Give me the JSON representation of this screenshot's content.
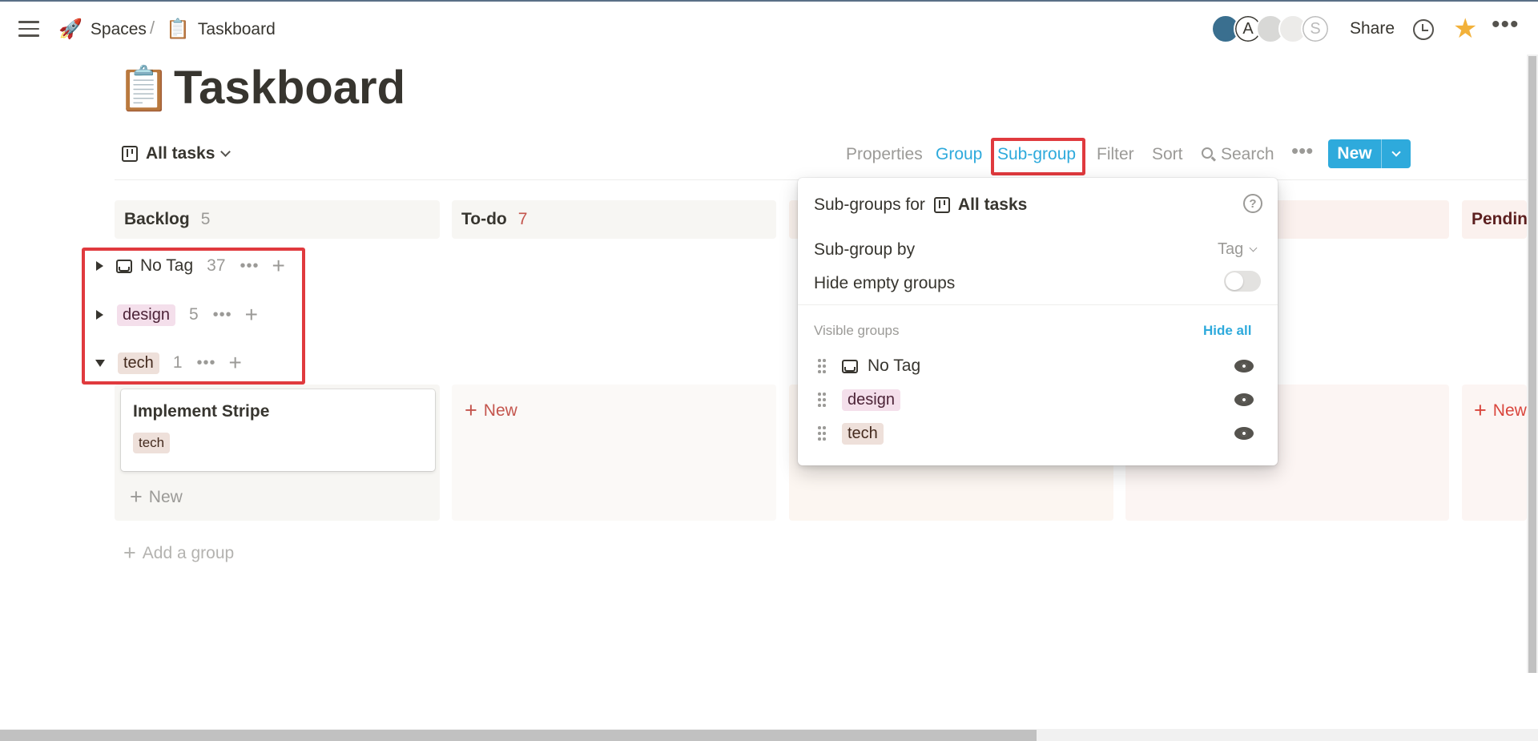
{
  "breadcrumb": {
    "items": [
      {
        "emoji": "🚀",
        "label": "Spaces"
      },
      {
        "emoji": "📋",
        "label": "Taskboard"
      }
    ],
    "separator": "/"
  },
  "topbar": {
    "avatars": [
      "",
      "A",
      "",
      "",
      "S"
    ],
    "share_label": "Share",
    "more_label": "•••"
  },
  "page": {
    "emoji": "📋",
    "title": "Taskboard"
  },
  "view": {
    "name": "All tasks"
  },
  "viewbar": {
    "properties": "Properties",
    "group": "Group",
    "subgroup": "Sub-group",
    "filter": "Filter",
    "sort": "Sort",
    "search": "Search",
    "more": "•••",
    "new": "New"
  },
  "columns": [
    {
      "name": "Backlog",
      "count": "5",
      "bg": "#f7f6f3",
      "count_color": "#9b9a97"
    },
    {
      "name": "To-do",
      "count": "7",
      "bg": "#f7f6f3",
      "count_color": "#c4554d"
    },
    {
      "name": "",
      "count": "",
      "bg": "#fbf3ee",
      "count_color": "#9b9a97"
    },
    {
      "name": "",
      "count": "",
      "bg": "#fbf1ee",
      "count_color": "#9b9a97"
    },
    {
      "name": "Pending",
      "count": "",
      "bg": "#fbf1ee",
      "count_color": "#9b9a97"
    }
  ],
  "subgroups": [
    {
      "label": "No Tag",
      "count": "37",
      "expanded": false,
      "icon": "tray-icon"
    },
    {
      "label": "design",
      "count": "5",
      "expanded": false
    },
    {
      "label": "tech",
      "count": "1",
      "expanded": true
    }
  ],
  "card": {
    "title": "Implement Stripe",
    "tag": "tech"
  },
  "board": {
    "new_label": "New",
    "add_group": "Add a group"
  },
  "popover": {
    "title_prefix": "Sub-groups for",
    "view_name": "All tasks",
    "help": "?",
    "subgroup_by_label": "Sub-group by",
    "subgroup_by_value": "Tag",
    "hide_empty_label": "Hide empty groups",
    "hide_empty_on": false,
    "visible_groups_label": "Visible groups",
    "hide_all": "Hide all",
    "visible_groups": [
      "No Tag",
      "design",
      "tech"
    ]
  },
  "colors": {
    "accent": "#2eaadc",
    "highlight": "#e03a3e",
    "star": "#f2b13a",
    "tag_design_bg": "#f4dfeb",
    "tag_tech_bg": "#eee0da"
  }
}
